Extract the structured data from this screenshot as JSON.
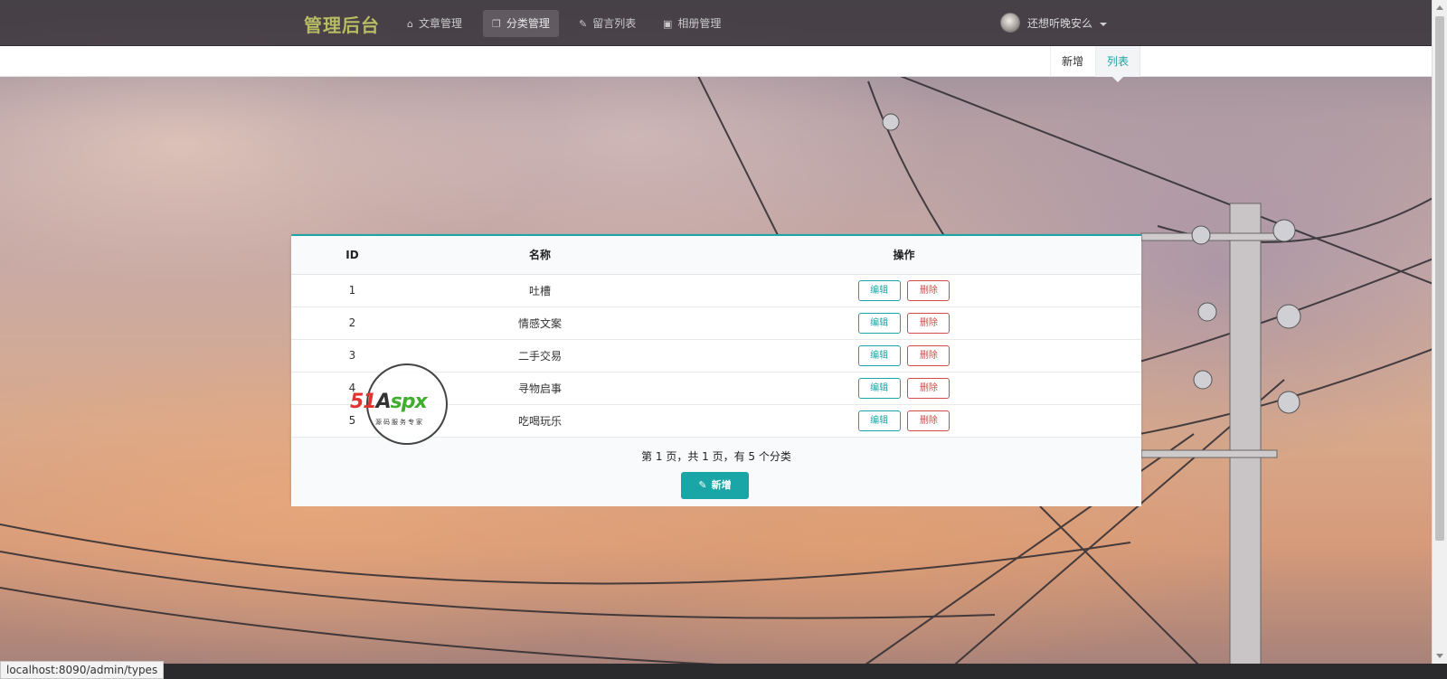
{
  "header": {
    "brand": "管理后台",
    "nav": [
      {
        "label": "文章管理",
        "icon": "home-icon",
        "active": false
      },
      {
        "label": "分类管理",
        "icon": "copy-icon",
        "active": true
      },
      {
        "label": "留言列表",
        "icon": "pencil-icon",
        "active": false
      },
      {
        "label": "相册管理",
        "icon": "image-icon",
        "active": false
      }
    ],
    "user": {
      "name": "还想听晚安么",
      "icon": "avatar"
    }
  },
  "subnav": {
    "tabs": [
      {
        "label": "新增",
        "active": false
      },
      {
        "label": "列表",
        "active": true
      }
    ]
  },
  "table": {
    "columns": [
      "ID",
      "名称",
      "操作"
    ],
    "rows": [
      {
        "id": "1",
        "name": "吐槽"
      },
      {
        "id": "2",
        "name": "情感文案"
      },
      {
        "id": "3",
        "name": "二手交易"
      },
      {
        "id": "4",
        "name": "寻物启事"
      },
      {
        "id": "5",
        "name": "吃喝玩乐"
      }
    ],
    "edit_label": "编辑",
    "delete_label": "删除",
    "pagination": "第 1 页，共 1 页，有 5 个分类",
    "add_label": "新增"
  },
  "watermark": {
    "text_red": "51",
    "text_dark": "A",
    "text_green": "spx",
    "sub": "源码服务专家"
  },
  "status_url": "localhost:8090/admin/types",
  "colors": {
    "accent": "#1aa5a6",
    "danger": "#d24a4a",
    "brand": "#b5bc62",
    "topbar": "#3c373c"
  }
}
